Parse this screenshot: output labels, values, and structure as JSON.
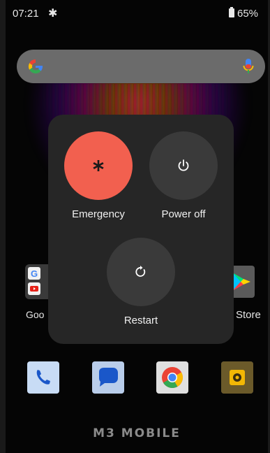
{
  "status_bar": {
    "time": "07:21",
    "gear_icon": "gear-icon",
    "battery_icon": "battery-icon",
    "battery": "65%"
  },
  "search": {
    "logo_icon": "google-g-icon",
    "mic_icon": "mic-icon"
  },
  "home_apps": [
    {
      "label": "Goo",
      "icon": "google-folder-icon"
    },
    {
      "label": "Store",
      "icon": "play-store-icon"
    }
  ],
  "dock": [
    {
      "icon": "phone-icon"
    },
    {
      "icon": "messages-icon"
    },
    {
      "icon": "chrome-icon"
    },
    {
      "icon": "camera-app-icon"
    }
  ],
  "power_menu": {
    "emergency": {
      "label": "Emergency",
      "icon": "asterisk-icon"
    },
    "power_off": {
      "label": "Power off",
      "icon": "power-icon"
    },
    "restart": {
      "label": "Restart",
      "icon": "restart-icon"
    }
  },
  "brand": "M3 MOBILE",
  "colors": {
    "emergency": "#f2604f",
    "menu_bg": "#262626",
    "button_bg": "#3a3a3a"
  }
}
